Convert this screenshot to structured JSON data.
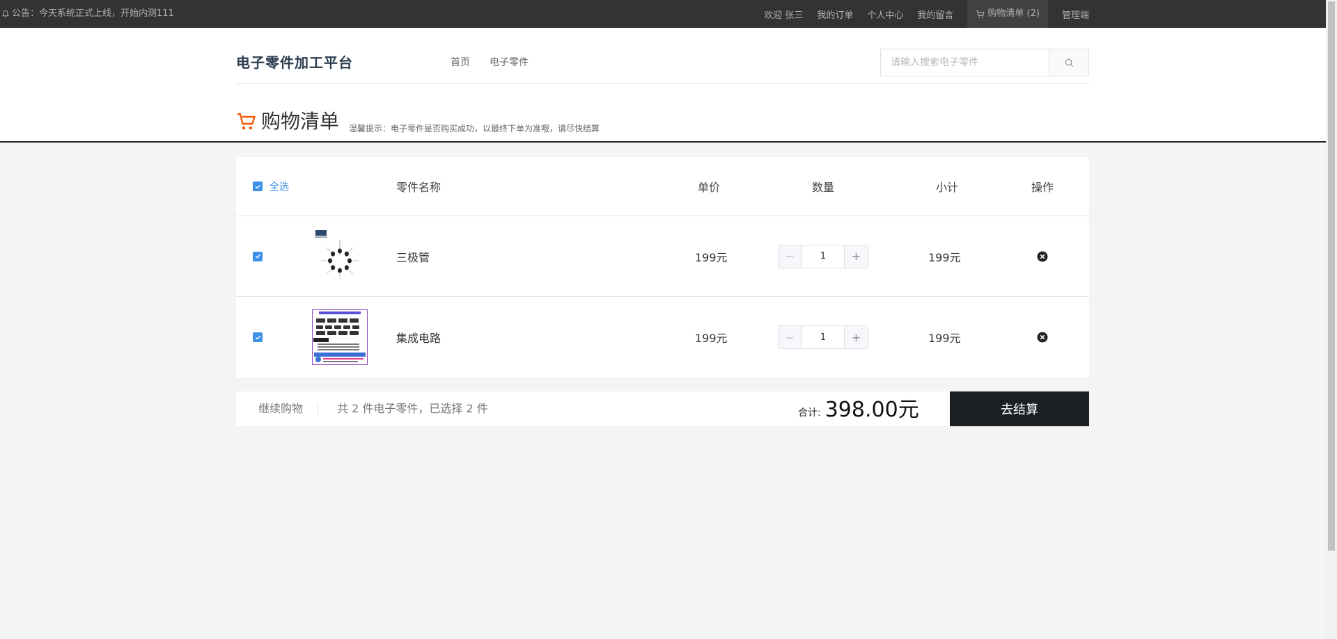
{
  "topbar": {
    "notice": "公告：今天系统正式上线，开始内测111",
    "welcome": "欢迎 张三",
    "links": [
      "我的订单",
      "个人中心",
      "我的留言"
    ],
    "cart_label": "购物清单 (2)",
    "admin": "管理端"
  },
  "header": {
    "logo": "电子零件加工平台",
    "nav": [
      "首页",
      "电子零件"
    ],
    "search_placeholder": "请输入搜索电子零件",
    "page_title": "购物清单",
    "tip": "温馨提示：电子零件是否购买成功，以最终下单为准哦，请尽快结算"
  },
  "table": {
    "select_all": "全选",
    "columns": {
      "name": "零件名称",
      "price": "单价",
      "qty": "数量",
      "subtotal": "小计",
      "action": "操作"
    },
    "rows": [
      {
        "name": "三极管",
        "price": "199元",
        "qty": "1",
        "subtotal": "199元",
        "checked": true
      },
      {
        "name": "集成电路",
        "price": "199元",
        "qty": "1",
        "subtotal": "199元",
        "checked": true
      }
    ]
  },
  "summary": {
    "continue": "继续购物",
    "info": "共 2 件电子零件，已选择 2 件",
    "total_label": "合计:",
    "total_amount": "398.00元",
    "checkout": "去结算"
  },
  "colors": {
    "topbar": "#333333",
    "accent_blue": "#3c91e6",
    "cart_orange": "#f25807",
    "checkout_bg": "#1b1f24"
  }
}
